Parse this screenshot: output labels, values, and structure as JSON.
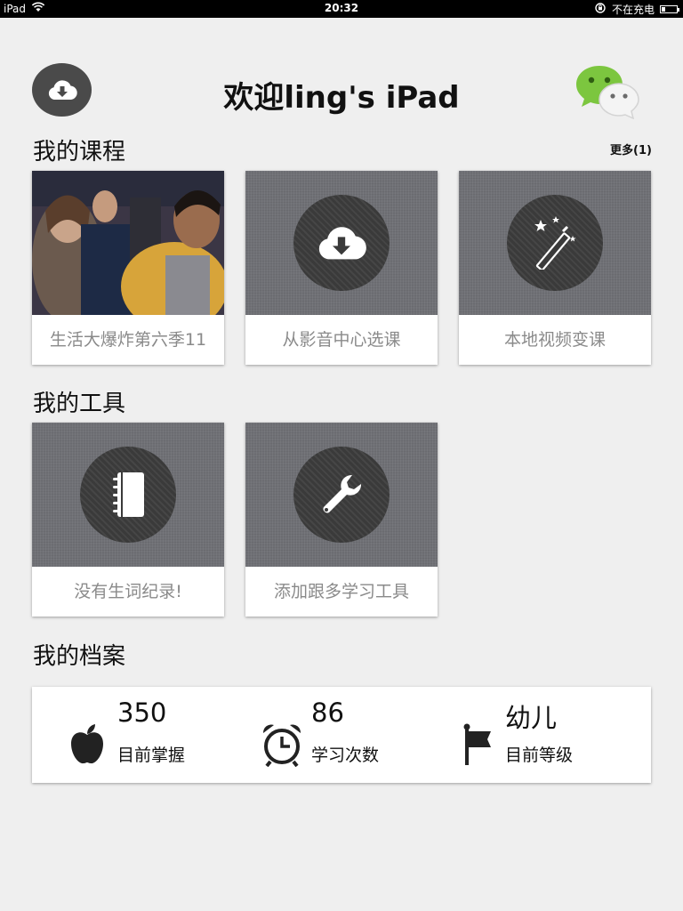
{
  "status_bar": {
    "device": "iPad",
    "time": "20:32",
    "charging_text": "不在充电",
    "battery_level": 0.25
  },
  "header": {
    "title": "欢迎ling's iPad",
    "left_icon": "cloud-download-icon",
    "right_icon": "wechat-icon"
  },
  "courses": {
    "title": "我的课程",
    "more_label": "更多(1)",
    "items": [
      {
        "label": "生活大爆炸第六季11",
        "thumb": "video-thumbnail"
      },
      {
        "label": "从影音中心选课",
        "icon": "cloud-download-icon"
      },
      {
        "label": "本地视频变课",
        "icon": "magic-wand-icon"
      }
    ]
  },
  "tools": {
    "title": "我的工具",
    "items": [
      {
        "label": "没有生词纪录!",
        "icon": "notebook-icon"
      },
      {
        "label": "添加跟多学习工具",
        "icon": "wrench-icon"
      }
    ]
  },
  "profile": {
    "title": "我的档案",
    "stats": [
      {
        "value": "350",
        "label": "目前掌握",
        "icon": "apple-icon"
      },
      {
        "value": "86",
        "label": "学习次数",
        "icon": "alarm-clock-icon"
      },
      {
        "value": "幼儿",
        "label": "目前等级",
        "icon": "flag-icon"
      }
    ]
  }
}
